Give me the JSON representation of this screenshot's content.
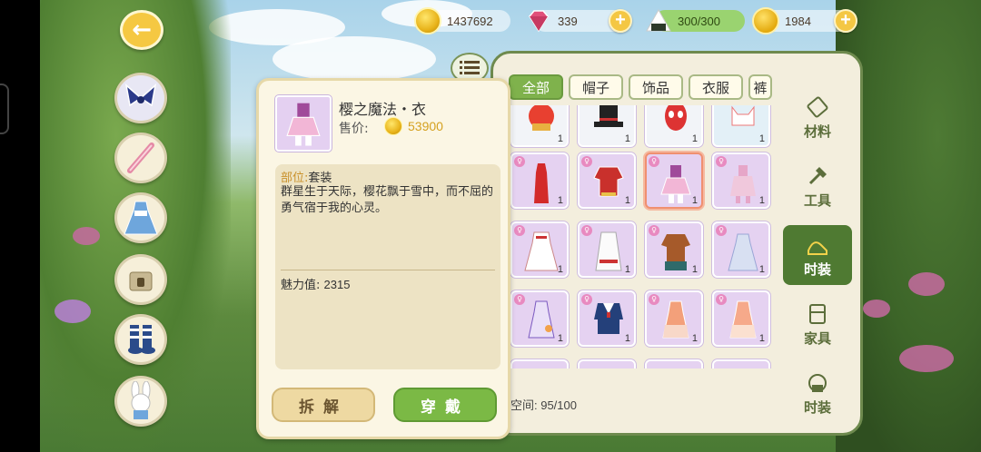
{
  "resources": {
    "coins": "1437692",
    "gems": "339",
    "stamina": "300/300",
    "yarn": "1984"
  },
  "top_tabs": [
    "全部",
    "帽子",
    "饰品",
    "衣服",
    "裤"
  ],
  "categories": [
    "材料",
    "工具",
    "时装",
    "家具",
    "时装"
  ],
  "item": {
    "name": "樱之魔法・衣",
    "price_label": "售价:",
    "price": "53900",
    "part_key": "部位:",
    "part_value": "套装",
    "flavor": "群星生于天际，樱花飘于雪中，而不屈的勇气宿于我的心灵。",
    "charm_label": "魅力值:",
    "charm_value": "2315"
  },
  "buttons": {
    "disassemble": "拆解",
    "wear": "穿戴"
  },
  "storage": "空间: 95/100",
  "grid_counts": [
    "1",
    "1",
    "1",
    "1",
    "1",
    "1",
    "1",
    "1",
    "1",
    "1",
    "1",
    "1",
    "1",
    "1",
    "1",
    "1"
  ],
  "colors": {
    "accent_green": "#7fb24c",
    "panel_border": "#6e8a4e",
    "cell_purple": "#e5d2f1",
    "gold": "#d5a120"
  }
}
